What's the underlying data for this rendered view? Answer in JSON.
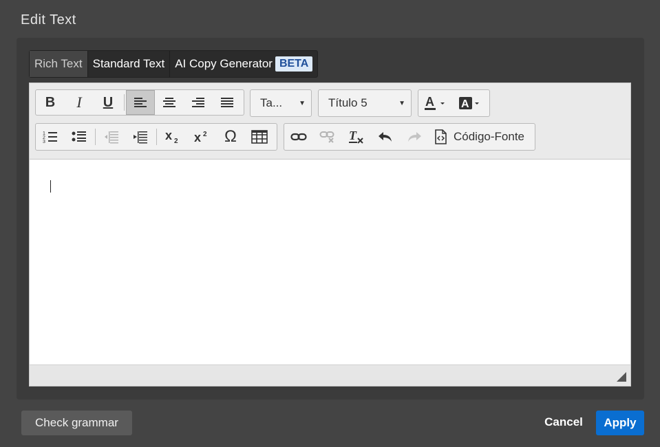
{
  "dialog": {
    "title": "Edit Text"
  },
  "tabs": [
    {
      "label": "Rich Text",
      "active": true
    },
    {
      "label": "Standard Text"
    },
    {
      "label": "AI Copy Generator",
      "badge": "BETA"
    }
  ],
  "toolbar": {
    "font_size_value": "Ta...",
    "block_format_value": "Título 5",
    "source_label": "Código-Fonte"
  },
  "footer": {
    "check_grammar_label": "Check grammar",
    "cancel_label": "Cancel",
    "apply_label": "Apply"
  },
  "colors": {
    "background": "#444444",
    "panel": "#3b3b3b",
    "apply": "#0a6ed1",
    "beta": "#dce9f7"
  }
}
